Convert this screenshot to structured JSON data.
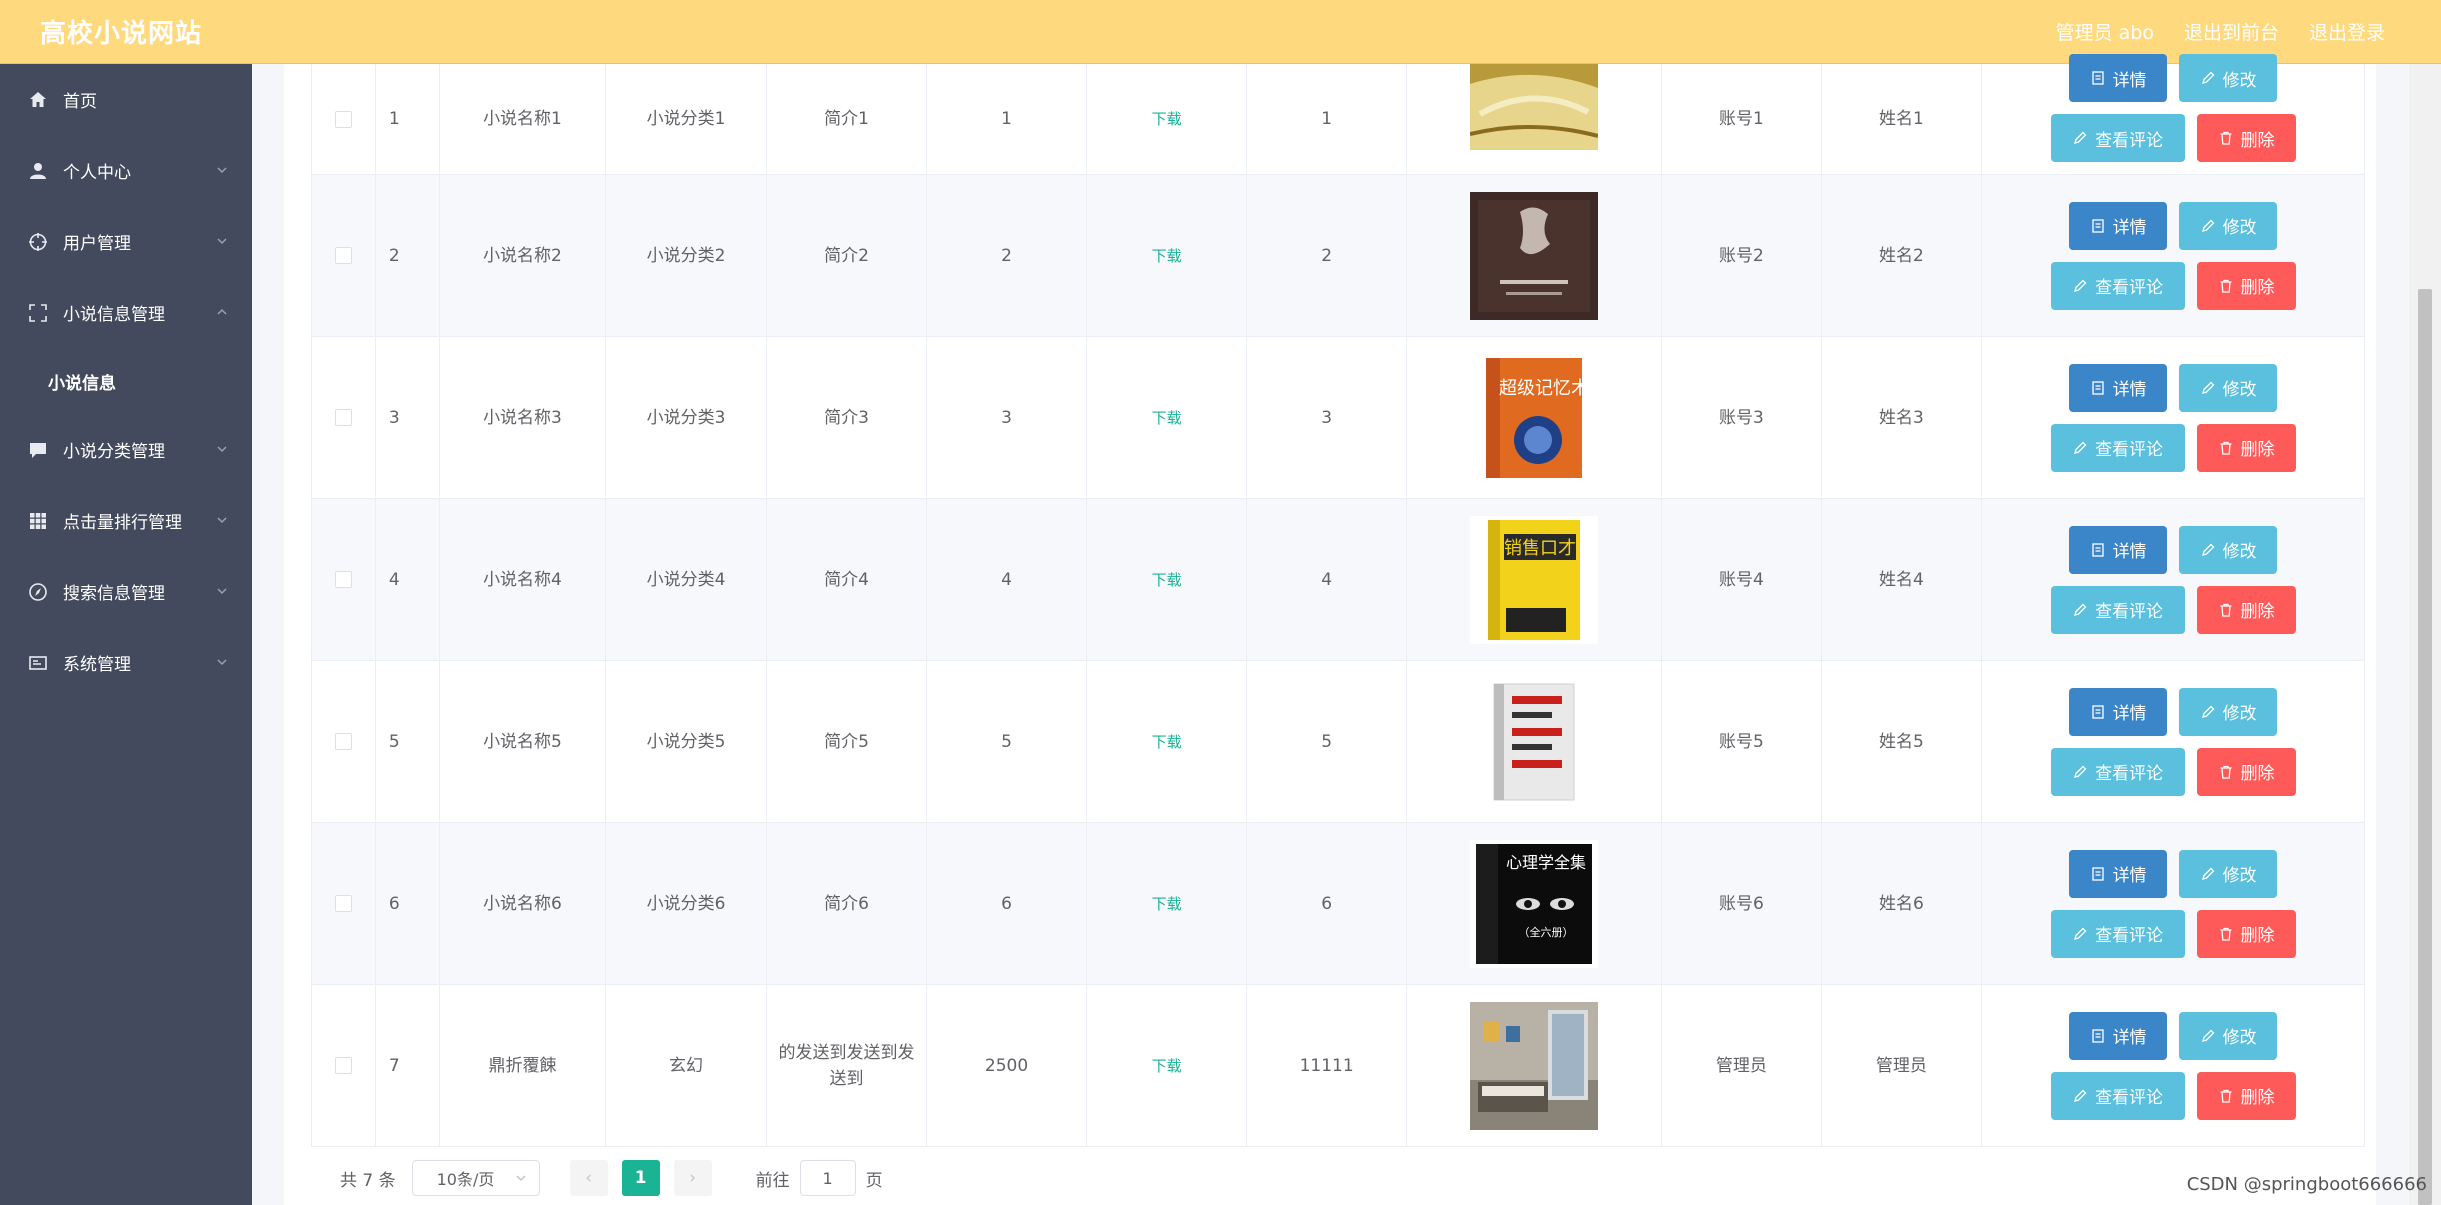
{
  "header": {
    "title": "高校小说网站",
    "admin_label": "管理员 abo",
    "to_front": "退出到前台",
    "logout": "退出登录"
  },
  "sidebar": {
    "items": [
      {
        "label": "首页",
        "icon": "home-icon"
      },
      {
        "label": "个人中心",
        "icon": "user-icon"
      },
      {
        "label": "用户管理",
        "icon": "crosshair-icon"
      },
      {
        "label": "小说信息管理",
        "icon": "expand-icon"
      },
      {
        "label": "小说分类管理",
        "icon": "chat-icon"
      },
      {
        "label": "点击量排行管理",
        "icon": "grid-icon"
      },
      {
        "label": "搜索信息管理",
        "icon": "compass-icon"
      },
      {
        "label": "系统管理",
        "icon": "window-icon"
      }
    ],
    "sub_item": "小说信息"
  },
  "table": {
    "download_text": "下载",
    "buttons": {
      "detail": "详情",
      "edit": "修改",
      "comment": "查看评论",
      "delete": "删除"
    },
    "rows": [
      {
        "index": "1",
        "name": "小说名称1",
        "category": "小说分类1",
        "intro": "简介1",
        "num": "1",
        "clicks": "1",
        "account": "账号1",
        "username": "姓名1"
      },
      {
        "index": "2",
        "name": "小说名称2",
        "category": "小说分类2",
        "intro": "简介2",
        "num": "2",
        "clicks": "2",
        "account": "账号2",
        "username": "姓名2"
      },
      {
        "index": "3",
        "name": "小说名称3",
        "category": "小说分类3",
        "intro": "简介3",
        "num": "3",
        "clicks": "3",
        "account": "账号3",
        "username": "姓名3"
      },
      {
        "index": "4",
        "name": "小说名称4",
        "category": "小说分类4",
        "intro": "简介4",
        "num": "4",
        "clicks": "4",
        "account": "账号4",
        "username": "姓名4"
      },
      {
        "index": "5",
        "name": "小说名称5",
        "category": "小说分类5",
        "intro": "简介5",
        "num": "5",
        "clicks": "5",
        "account": "账号5",
        "username": "姓名5"
      },
      {
        "index": "6",
        "name": "小说名称6",
        "category": "小说分类6",
        "intro": "简介6",
        "num": "6",
        "clicks": "6",
        "account": "账号6",
        "username": "姓名6"
      },
      {
        "index": "7",
        "name": "鼎折覆餗",
        "category": "玄幻",
        "intro": "的发送到发送到发送到",
        "num": "2500",
        "clicks": "11111",
        "account": "管理员",
        "username": "管理员"
      }
    ],
    "covers": {
      "r3_title": "超级记忆术",
      "r4_title": "销售口才",
      "r6_title": "心理学全集",
      "r6_sub": "（全六册）"
    }
  },
  "pagination": {
    "total": "共 7 条",
    "page_size": "10条/页",
    "prev": "‹",
    "current": "1",
    "next": "›",
    "goto_label": "前往",
    "goto_value": "1",
    "page_unit": "页"
  },
  "watermark": "CSDN @springboot666666",
  "colors": {
    "header_bg": "#ffd97e",
    "sidebar_bg": "#434a5d",
    "accent_green": "#1ab394",
    "btn_blue": "#3a86c8",
    "btn_cyan": "#5bc0de",
    "btn_red": "#ff5a5a"
  }
}
